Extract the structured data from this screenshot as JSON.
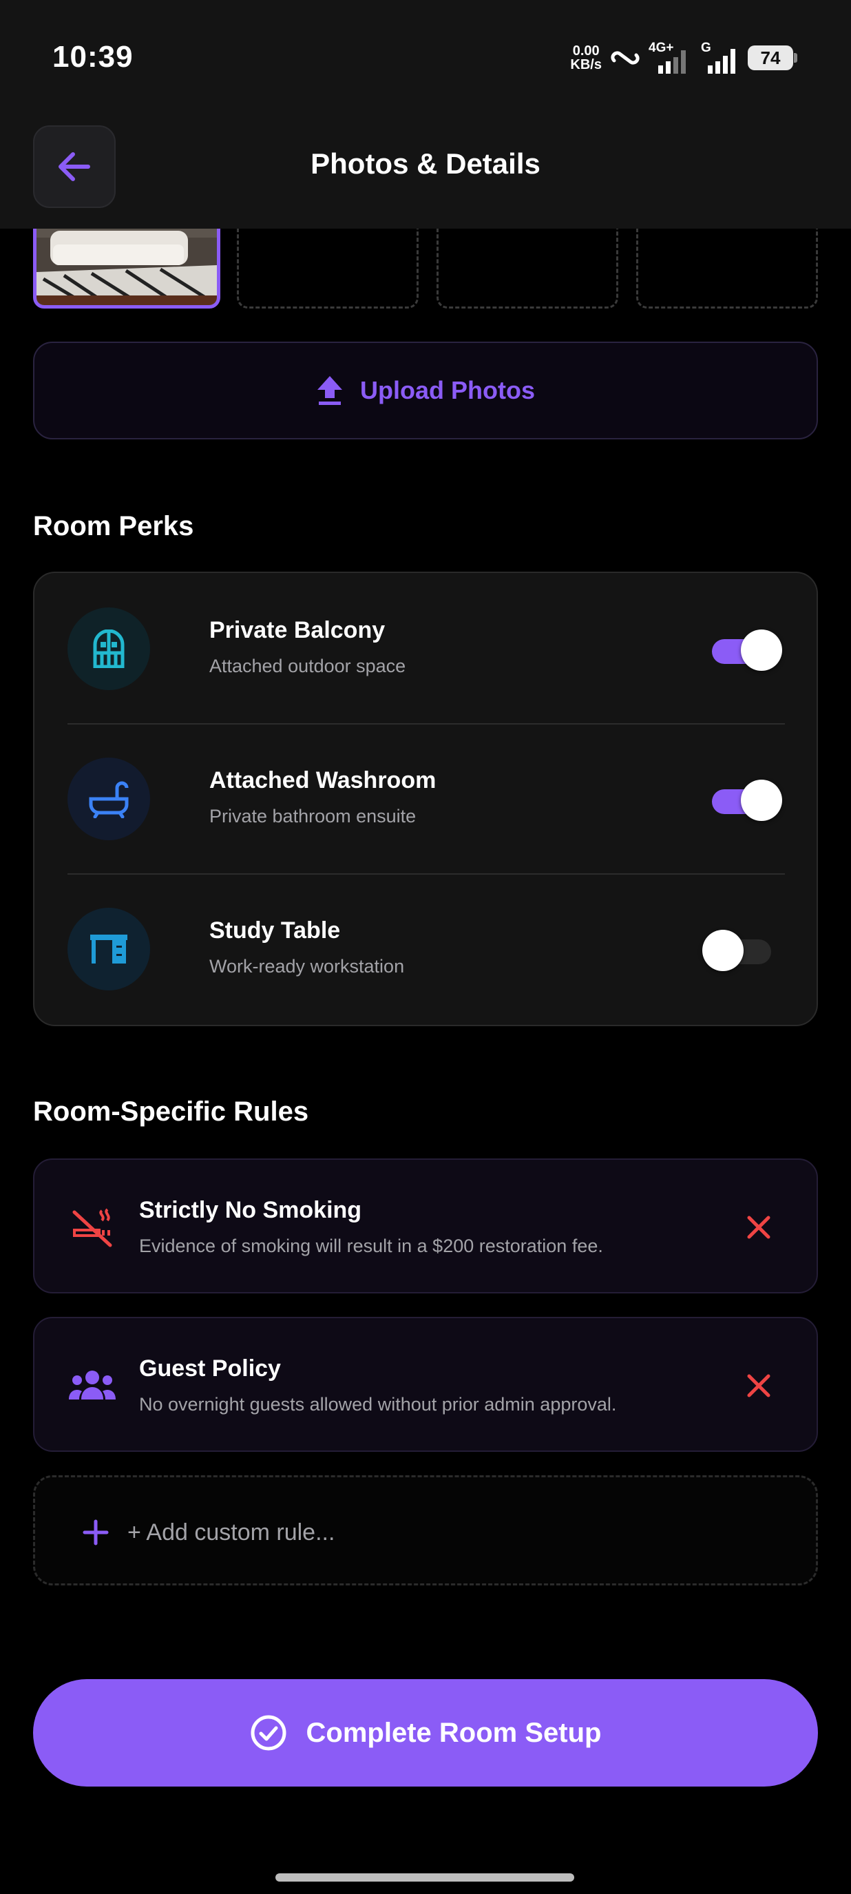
{
  "status_bar": {
    "time": "10:39",
    "net_speed_value": "0.00",
    "net_speed_unit": "KB/s",
    "network_1": "4G+",
    "network_2": "G",
    "battery": "74"
  },
  "header": {
    "title": "Photos & Details"
  },
  "upload": {
    "label": "Upload Photos"
  },
  "perks": {
    "section_title": "Room Perks",
    "items": [
      {
        "name": "Private Balcony",
        "description": "Attached outdoor space",
        "enabled": true,
        "icon": "door-icon"
      },
      {
        "name": "Attached Washroom",
        "description": "Private bathroom ensuite",
        "enabled": true,
        "icon": "bathtub-icon"
      },
      {
        "name": "Study Table",
        "description": "Work-ready workstation",
        "enabled": false,
        "icon": "desk-icon"
      }
    ]
  },
  "rules": {
    "section_title": "Room-Specific Rules",
    "items": [
      {
        "title": "Strictly No Smoking",
        "description": "Evidence of smoking will result in a $200 restoration fee.",
        "icon": "no-smoking-icon"
      },
      {
        "title": "Guest Policy",
        "description": "No overnight guests allowed without prior admin approval.",
        "icon": "group-icon"
      }
    ],
    "add_placeholder": "+ Add custom rule..."
  },
  "footer": {
    "complete_label": "Complete Room Setup"
  },
  "colors": {
    "accent": "#8b5cf6",
    "danger": "#ef4444",
    "teal": "#22b8cf",
    "blue": "#3b82f6"
  }
}
